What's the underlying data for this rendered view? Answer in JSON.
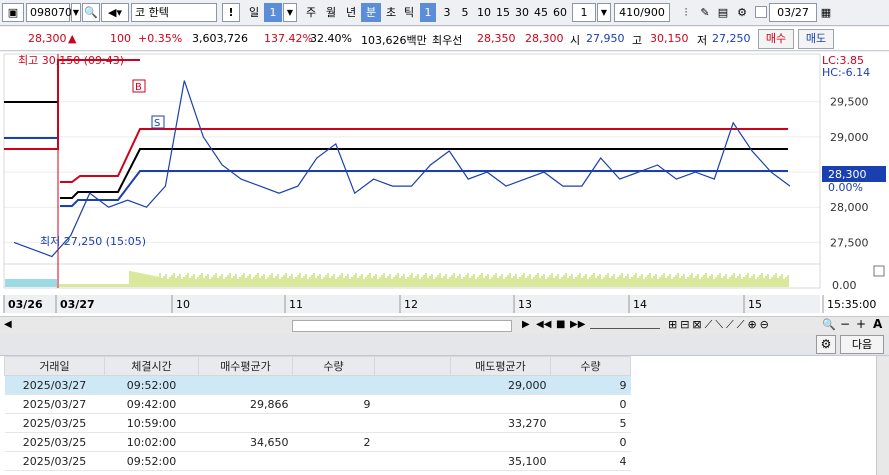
{
  "toolbar": {
    "code": "098070",
    "name": "한텍",
    "mode_prefix": "코",
    "exclaim": "!",
    "period_day": "일",
    "period_val": "1",
    "periods": [
      "주",
      "월",
      "년",
      "분",
      "초",
      "틱"
    ],
    "minute_opts": [
      "1",
      "3",
      "5",
      "10",
      "15",
      "30",
      "45",
      "60"
    ],
    "interval_val": "1",
    "count": "410/900",
    "date": "03/27"
  },
  "quote": {
    "price": "28,300",
    "arrow": "▲",
    "change": "100",
    "change_pct": "+0.35%",
    "volume": "3,603,726",
    "vol_ratio": "137.42%",
    "turnover": "32.40%",
    "amount": "103,626백만",
    "best_label": "최우선",
    "best_ask": "28,350",
    "best_bid": "28,300",
    "open_label": "시",
    "open": "27,950",
    "high_label": "고",
    "high": "30,150",
    "low_label": "저",
    "low": "27,250",
    "buy_label": "매수",
    "sell_label": "매도"
  },
  "chart": {
    "lc": "LC:3.85",
    "hc": "HC:-6.14",
    "high_note": "최고 30,150 (09:43)",
    "low_note": "최저 27,250 (15:05)",
    "y_ticks": [
      "29,500",
      "29,000",
      "28,500",
      "28,000",
      "27,500"
    ],
    "current": "28,300",
    "current_pct": "0.00%",
    "vol_tick": "0.00",
    "x_labels": [
      "03/26",
      "03/27",
      "10",
      "11",
      "12",
      "13",
      "14",
      "15",
      "15:35:00"
    ],
    "marker_b": "B",
    "marker_s": "S",
    "colors": {
      "up": "#d0021b",
      "down": "#1a3fb0",
      "volume": "#b5d13a",
      "ma": "#000000"
    }
  },
  "chart_data": {
    "type": "line",
    "title": "",
    "ylim": [
      27250,
      30150
    ],
    "series": [
      {
        "name": "",
        "values": [
          27500,
          27400,
          27300,
          27600,
          28200,
          28000,
          28100,
          28000,
          28300,
          29800,
          29000,
          28600,
          28400,
          28300,
          28200,
          28300,
          28700,
          28900,
          28200,
          28400,
          28300,
          28300,
          28600,
          28800,
          28400,
          28500,
          28300,
          28400,
          28500,
          28300,
          28300,
          28700,
          28400,
          28500,
          28600,
          28400,
          28500,
          28400,
          29200,
          28800,
          28500,
          28300
        ]
      }
    ]
  },
  "panel": {
    "next_label": "다음",
    "columns": [
      "거래일",
      "체결시간",
      "매수평균가",
      "수량",
      "",
      "매도평균가",
      "수량"
    ],
    "rows": [
      [
        "2025/03/27",
        "09:52:00",
        "",
        "",
        "",
        "29,000",
        "9"
      ],
      [
        "2025/03/27",
        "09:42:00",
        "29,866",
        "9",
        "",
        "",
        "0"
      ],
      [
        "2025/03/25",
        "10:59:00",
        "",
        "",
        "",
        "33,270",
        "5"
      ],
      [
        "2025/03/25",
        "10:02:00",
        "34,650",
        "2",
        "",
        "",
        "0"
      ],
      [
        "2025/03/25",
        "09:52:00",
        "",
        "",
        "",
        "35,100",
        "4"
      ]
    ]
  }
}
